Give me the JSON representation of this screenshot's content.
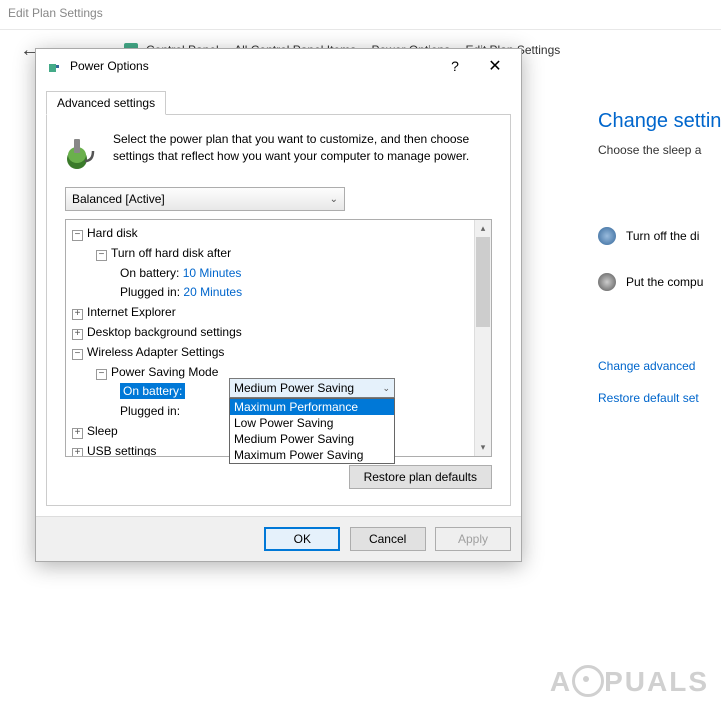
{
  "bgWindow": {
    "title": "Edit Plan Settings",
    "breadcrumb": [
      "Control Panel",
      "All Control Panel Items",
      "Power Options",
      "Edit Plan Settings"
    ]
  },
  "bgContent": {
    "heading": "Change settings",
    "sub": "Choose the sleep a",
    "row1": "Turn off the di",
    "row2": "Put the compu",
    "link1": "Change advanced",
    "link2": "Restore default set"
  },
  "dialog": {
    "title": "Power Options",
    "tab": "Advanced settings",
    "intro": "Select the power plan that you want to customize, and then choose settings that reflect how you want your computer to manage power.",
    "plan": "Balanced [Active]",
    "restoreBtn": "Restore plan defaults",
    "okBtn": "OK",
    "cancelBtn": "Cancel",
    "applyBtn": "Apply"
  },
  "tree": {
    "hardDisk": "Hard disk",
    "turnOffHd": "Turn off hard disk after",
    "onBattery1Label": "On battery:",
    "onBattery1Value": "10 Minutes",
    "pluggedIn1Label": "Plugged in:",
    "pluggedIn1Value": "20 Minutes",
    "ie": "Internet Explorer",
    "desktopBg": "Desktop background settings",
    "wireless": "Wireless Adapter Settings",
    "powerSaving": "Power Saving Mode",
    "onBattery2Label": "On battery:",
    "pluggedIn2Label": "Plugged in:",
    "sleep": "Sleep",
    "usb": "USB settings"
  },
  "combo": {
    "selected": "Medium Power Saving",
    "options": [
      "Maximum Performance",
      "Low Power Saving",
      "Medium Power Saving",
      "Maximum Power Saving"
    ],
    "highlightIndex": 0
  },
  "watermark": "APPUALS"
}
